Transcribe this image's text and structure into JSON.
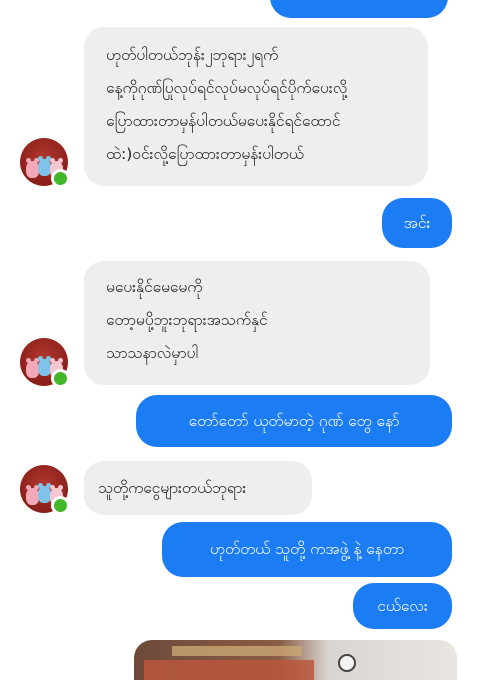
{
  "messages": [
    {
      "direction": "out",
      "text": ""
    },
    {
      "direction": "in",
      "text": "ဟုတ်ပါတယ်ဘုန်း၂ဘုရား၂ရက်\nနေ့ကိုဂုဏ်ပြုလုပ်ရင်လုပ်မလုပ်ရင်ပိုက်ပေးလို့\nပြောထားတာမှန်ပါတယ်မပေးနိုင်ရင်ထောင်\nထဲ:)ဝင်းလို့ပြောထားတာမှန်းပါတယ်"
    },
    {
      "direction": "out",
      "text": "အင်း"
    },
    {
      "direction": "in",
      "text": "မပေးနိုင်မေမေကို\nတော့မပို့ဘူးဘုရားအသက်နှင်\nသာသနာလဲမှာပါ"
    },
    {
      "direction": "out",
      "text": "တော်တော် ယုတ်မာတဲ့ ဂုဏ် တွေ နော်"
    },
    {
      "direction": "in",
      "text": "သူတို့ကငွေများတယ်ဘုရား"
    },
    {
      "direction": "out",
      "text": "ဟုတ်တယ် သူတို့ ကအဖွဲ့ နဲ့ နေတာ"
    },
    {
      "direction": "out",
      "text": "ငယ်လေး"
    },
    {
      "direction": "out",
      "type": "photo"
    }
  ],
  "contact": {
    "avatar": "teddy-bears-avatar",
    "status": "online"
  },
  "colors": {
    "outgoing": "#1c7cf4",
    "incoming": "#eeeeef",
    "online": "#42b72a"
  }
}
